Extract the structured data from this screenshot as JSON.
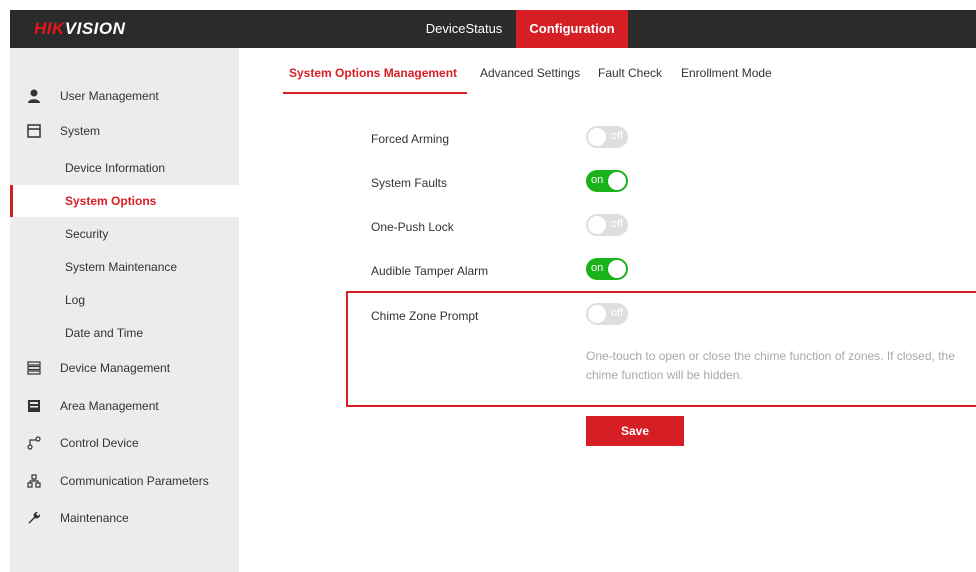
{
  "brand": {
    "logo_red": "HIK",
    "logo_white": "VISION"
  },
  "topnav": {
    "device_status": "DeviceStatus",
    "configuration": "Configuration"
  },
  "colors": {
    "accent": "#d51f24",
    "toggle_on": "#1ab21a",
    "toggle_off": "#d4d4d4",
    "topbar": "#2b2b2b",
    "sidebar": "#ececec"
  },
  "sidebar": {
    "user_management": {
      "label": "User Management",
      "icon": "user-icon"
    },
    "system": {
      "label": "System",
      "icon": "system-icon"
    },
    "sub": {
      "device_information": "Device Information",
      "system_options": "System Options",
      "security": "Security",
      "system_maintenance": "System Maintenance",
      "log": "Log",
      "date_and_time": "Date and Time"
    },
    "device_management": {
      "label": "Device Management",
      "icon": "device-management-icon"
    },
    "area_management": {
      "label": "Area Management",
      "icon": "area-management-icon"
    },
    "control_device": {
      "label": "Control Device",
      "icon": "control-device-icon"
    },
    "communication_parameters": {
      "label": "Communication Parameters",
      "icon": "network-icon"
    },
    "maintenance": {
      "label": "Maintenance",
      "icon": "wrench-icon"
    }
  },
  "tabs": {
    "system_options_management": "System Options Management",
    "advanced_settings": "Advanced Settings",
    "fault_check": "Fault Check",
    "enrollment_mode": "Enrollment Mode"
  },
  "options": {
    "forced_arming": {
      "label": "Forced Arming",
      "state": "off"
    },
    "system_faults": {
      "label": "System Faults",
      "state": "on"
    },
    "one_push_lock": {
      "label": "One-Push Lock",
      "state": "off"
    },
    "audible_tamper_alarm": {
      "label": "Audible Tamper Alarm",
      "state": "on"
    },
    "chime_zone_prompt": {
      "label": "Chime Zone Prompt",
      "state": "off"
    }
  },
  "hint": "One-touch to open or close the chime function of zones. If closed, the chime function will be hidden.",
  "save_label": "Save"
}
